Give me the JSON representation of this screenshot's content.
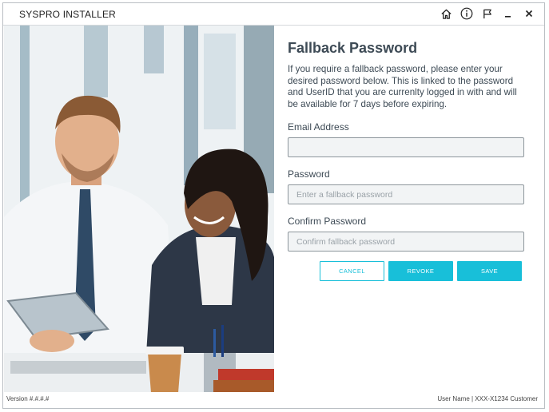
{
  "window": {
    "title": "SYSPRO INSTALLER",
    "icons": [
      "home-icon",
      "info-icon",
      "flag-icon",
      "minimize-icon",
      "close-icon"
    ]
  },
  "form": {
    "title": "Fallback Password",
    "description": "If you require a fallback password, please enter your desired password below. This is linked to the password and UserID that you are currenlty logged in with and will be available for 7 days before expiring.",
    "email_label": "Email Address",
    "email_value": "",
    "password_label": "Password",
    "password_placeholder": "Enter a fallback password",
    "confirm_label": "Confirm Password",
    "confirm_placeholder": "Confirm fallback password"
  },
  "buttons": {
    "cancel": "CANCEL",
    "revoke": "REVOKE",
    "save": "SAVE"
  },
  "footer": {
    "version": "Version #.#.#.#",
    "user": "User Name | XXX-X1234 Customer"
  },
  "colors": {
    "accent": "#18bfd9",
    "text": "#3d4a55"
  }
}
